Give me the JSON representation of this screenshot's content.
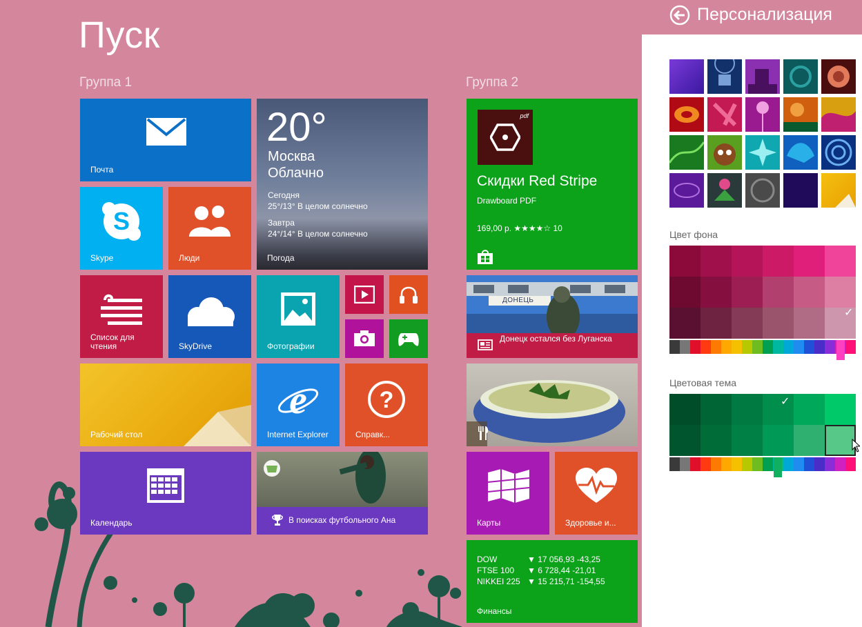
{
  "start": {
    "title": "Пуск",
    "groups": [
      "Группа 1",
      "Группа 2"
    ]
  },
  "tiles": {
    "mail": "Почта",
    "weather": {
      "temp": "20°",
      "city": "Москва",
      "condition": "Облачно",
      "today_label": "Сегодня",
      "today": "25°/13° В целом солнечно",
      "tomorrow_label": "Завтра",
      "tomorrow": "24°/14° В целом солнечно",
      "name": "Погода"
    },
    "skype": "Skype",
    "people": "Люди",
    "reading": "Список для чтения",
    "skydrive": "SkyDrive",
    "photos": "Фотографии",
    "desktop": "Рабочий стол",
    "ie": "Internet Explorer",
    "help": "Справк...",
    "calendar": "Календарь",
    "sport": "В поисках футбольного Ана",
    "store": {
      "title": "Скидки Red Stripe",
      "subtitle": "Drawboard PDF",
      "price": "169,00 р. ★★★★☆ 10",
      "pdf_mark": "pdf"
    },
    "news": {
      "headline": "Донецк остался без Луганска",
      "train_sign": "ДОНЕЦЬ"
    },
    "maps": "Карты",
    "health": "Здоровье и...",
    "finance": {
      "name": "Финансы",
      "rows": [
        {
          "index": "DOW",
          "value": "▼ 17 056,93 -43,25"
        },
        {
          "index": "FTSE 100",
          "value": "▼ 6 728,44 -21,01"
        },
        {
          "index": "NIKKEI 225",
          "value": "▼ 15 215,71 -154,55"
        }
      ]
    }
  },
  "personalization": {
    "title": "Персонализация",
    "bg_color_label": "Цвет фона",
    "accent_label": "Цветовая тема",
    "check": "✓",
    "bg_grid": [
      [
        "#8c0a3a",
        "#a0104a",
        "#b51558",
        "#cc1a66",
        "#e01f7a",
        "#f0449a"
      ],
      [
        "#6e0a30",
        "#851040",
        "#9c1e52",
        "#b2406e",
        "#c65b86",
        "#dc7fa2"
      ],
      [
        "#5a1030",
        "#6e2440",
        "#843c56",
        "#9a546c",
        "#b06c84",
        "#cd96ac"
      ]
    ],
    "accent_grid": [
      [
        "#004d2a",
        "#006534",
        "#007a40",
        "#008e4c",
        "#00a85a",
        "#00c96a"
      ],
      [
        "#00542e",
        "#006d38",
        "#008044",
        "#009a56",
        "#2fb070",
        "#58c888"
      ]
    ],
    "hue_strip": [
      "#3a3a3a",
      "#777777",
      "#e0102a",
      "#ff3a10",
      "#ff7a00",
      "#ffa800",
      "#f5c000",
      "#b8c800",
      "#6ebc20",
      "#00a050",
      "#00b8a0",
      "#00a8d8",
      "#1e8cf0",
      "#2050d8",
      "#4a2cc8",
      "#8a2cd8",
      "#d020c0",
      "#ff1078"
    ]
  }
}
